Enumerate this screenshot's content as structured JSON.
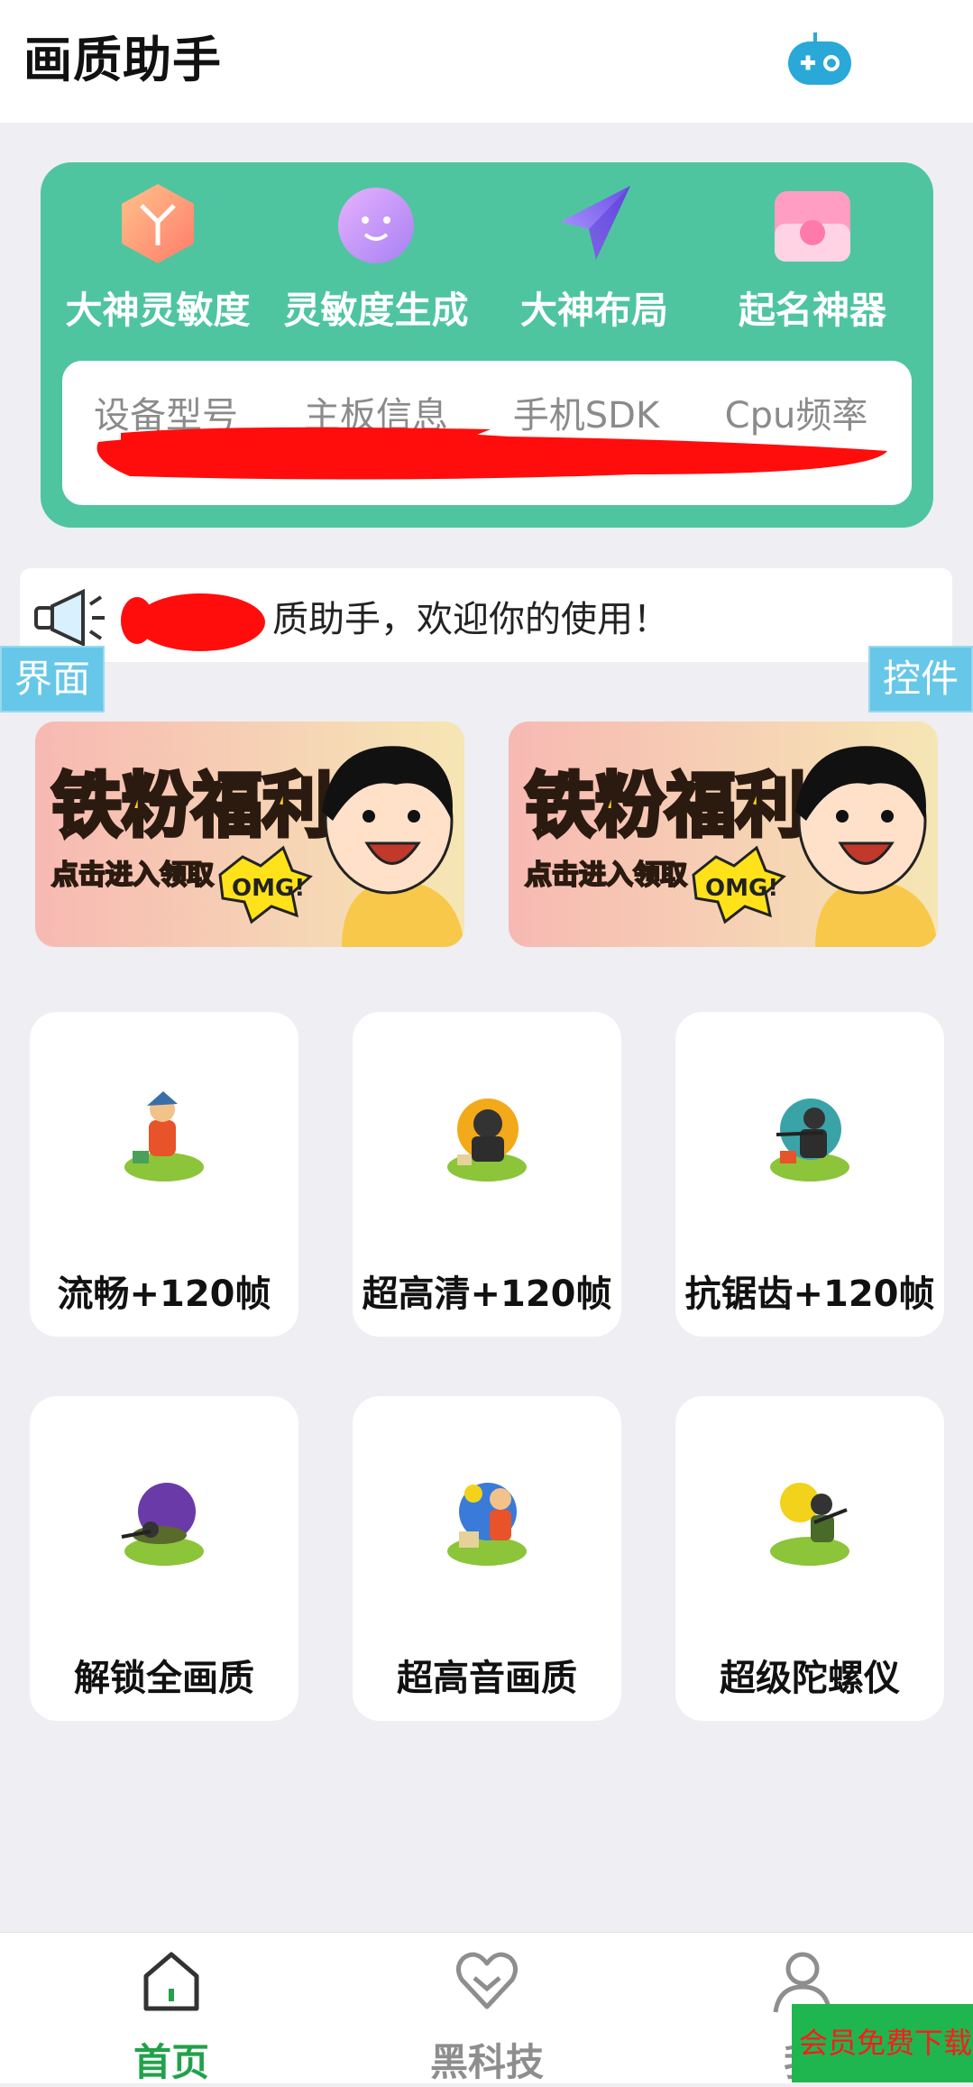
{
  "header": {
    "title": "画质助手"
  },
  "tools": [
    {
      "label": "大神灵敏度",
      "icon": "cube-icon"
    },
    {
      "label": "灵敏度生成",
      "icon": "smiley-icon"
    },
    {
      "label": "大神布局",
      "icon": "paper-plane-icon"
    },
    {
      "label": "起名神器",
      "icon": "card-icon"
    }
  ],
  "device_info": {
    "columns": [
      "设备型号",
      "主板信息",
      "手机SDK",
      "Cpu频率"
    ]
  },
  "notice": {
    "text": "质助手，欢迎你的使用！"
  },
  "tags": {
    "left": "界面",
    "right": "控件"
  },
  "banners": [
    {
      "title": "铁粉福利",
      "subtitle": "点击进入领取",
      "badge": "OMG!"
    },
    {
      "title": "铁粉福利",
      "subtitle": "点击进入领取",
      "badge": "OMG!"
    }
  ],
  "modes": [
    {
      "label": "流畅+120帧"
    },
    {
      "label": "超高清+120帧"
    },
    {
      "label": "抗锯齿+120帧"
    },
    {
      "label": "解锁全画质"
    },
    {
      "label": "超高音画质"
    },
    {
      "label": "超级陀螺仪"
    }
  ],
  "nav": [
    {
      "label": "首页",
      "icon": "home-icon",
      "active": true
    },
    {
      "label": "黑科技",
      "icon": "heart-icon",
      "active": false
    },
    {
      "label": "我",
      "icon": "person-icon",
      "active": false
    }
  ],
  "promo": {
    "text": "会员免费下载"
  },
  "colors": {
    "accent": "#4fc59f",
    "nav_active": "#21a24a",
    "nav_inactive": "#8e8e8e",
    "tag": "#66c7e8"
  }
}
